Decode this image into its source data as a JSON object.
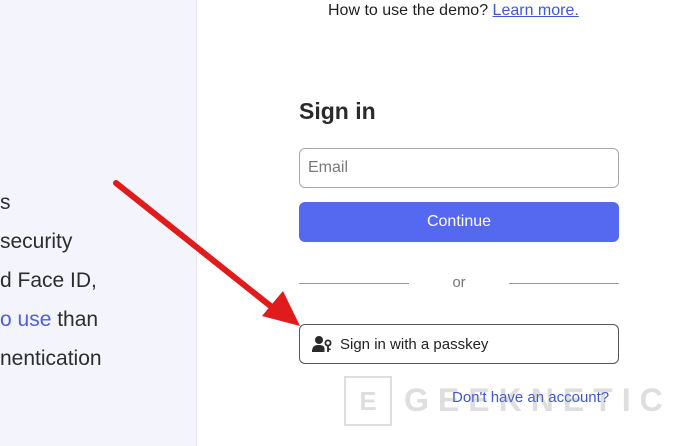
{
  "left_panel": {
    "lines": [
      {
        "text": "s"
      },
      {
        "text": " security"
      },
      {
        "text": "d Face ID,"
      },
      {
        "link": "o use",
        "text": " than"
      },
      {
        "text": "nentication"
      }
    ]
  },
  "top_note": {
    "text": "How to use the demo? ",
    "link": "Learn more."
  },
  "signin": {
    "title": "Sign in",
    "email_placeholder": "Email",
    "continue_label": "Continue",
    "divider_text": "or",
    "passkey_label": "Sign in with a passkey",
    "passkey_icon": "user-key-icon",
    "account_link": "Don't have an account?"
  },
  "watermark": {
    "box_letter": "E",
    "text": "GEEKNETIC"
  },
  "colors": {
    "accent": "#5468f0",
    "link": "#3e57d6",
    "arrow": "#e01b1b",
    "left_bg": "#f3f4fc"
  }
}
